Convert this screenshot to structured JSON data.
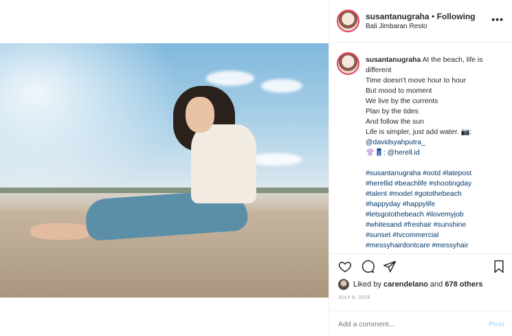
{
  "post": {
    "username": "susantanugraha",
    "separator": "•",
    "follow_status": "Following",
    "location": "Bali Jimbaran Resto",
    "more_label": "•••"
  },
  "caption": {
    "username": "susantanugraha",
    "first_line": "At the beach, life is different",
    "lines": [
      "Time doesn't move hour to hour",
      "But mood to moment",
      "We live by the currents",
      "Plan by the tides",
      "And follow the sun",
      "Life is simpler, just add water. 📷:"
    ],
    "photo_credit": "@davidsyahputra_",
    "outfit_credit_prefix": "👚👖:",
    "outfit_credit": "@herell.id",
    "hashtags": [
      "#susantanugraha #ootd #latepost",
      "#herellid #beachlife #shootingday",
      "#talent #model #gotothebeach",
      "#happyday #happylife",
      "#letsgotothebeach #ilovemyjob",
      "#whitesand #freshair #sunshine",
      "#sunset #tvcommercial",
      "#messyhairdontcare #messyhair"
    ]
  },
  "likes": {
    "prefix": "Liked by",
    "user": "carendelano",
    "middle": "and",
    "others": "678 others"
  },
  "date": "JULY 8, 2019",
  "comment": {
    "placeholder": "Add a comment...",
    "post_label": "Post"
  },
  "icons": {
    "like": "heart-icon",
    "comment": "comment-icon",
    "share": "paper-plane-icon",
    "save": "bookmark-icon"
  }
}
